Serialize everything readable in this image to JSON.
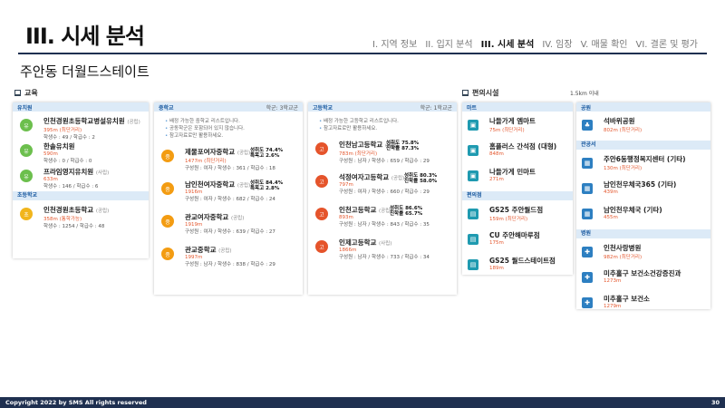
{
  "title": "III. 시세 분석",
  "nav": [
    "I. 지역 정보",
    "II. 입지 분석",
    "III. 시세 분석",
    "IV. 임장",
    "V. 매물 확인",
    "VI. 결론 및 평가"
  ],
  "subtitle": "주안동 더월드스테이트",
  "edu": {
    "header": "교육",
    "kinder": {
      "label": "유치원",
      "items": [
        {
          "name": "인천경원초등학교병설유치원",
          "tag": "(공립)",
          "dist": "395m",
          "near": "(최단거리)",
          "info": "학생수 : 49 / 학급수 : 2"
        },
        {
          "name": "한솔유치원",
          "tag": "",
          "dist": "590m",
          "near": "",
          "info": "학생수 : 0 / 학급수 : 0"
        },
        {
          "name": "프라임영지유치원",
          "tag": "(사립)",
          "dist": "633m",
          "near": "",
          "info": "학생수 : 146 / 학급수 : 6"
        }
      ]
    },
    "elem": {
      "label": "초등학교",
      "items": [
        {
          "name": "인천경원초등학교",
          "tag": "(공립)",
          "dist": "358m",
          "near": "(통학가능)",
          "info": "학생수 : 1254 / 학급수 : 48"
        }
      ]
    },
    "middle": {
      "label": "중학교",
      "right": "학군: 3학교군",
      "notes": [
        "배정 가능한 중학교 리스트입니다.",
        "공동학군은 포함되어 있지 않습니다.",
        "참고자료로만 활용하세요."
      ],
      "items": [
        {
          "name": "제물포여자중학교",
          "tag": "(공립)",
          "dist": "1477m",
          "near": "(최단거리)",
          "info": "구성원 : 여자 / 학생수 : 361 / 학급수 : 18",
          "rate1": "성취도 74.4%",
          "rate2": "특목고 2.6%"
        },
        {
          "name": "남인천여자중학교",
          "tag": "(공립)",
          "dist": "1916m",
          "near": "",
          "info": "구성원 : 여자 / 학생수 : 682 / 학급수 : 24",
          "rate1": "성취도 84.4%",
          "rate2": "특목고 2.8%"
        },
        {
          "name": "관교여자중학교",
          "tag": "(공립)",
          "dist": "1919m",
          "near": "",
          "info": "구성원 : 여자 / 학생수 : 639 / 학급수 : 27",
          "rate1": "",
          "rate2": ""
        },
        {
          "name": "관교중학교",
          "tag": "(공립)",
          "dist": "1997m",
          "near": "",
          "info": "구성원 : 남자 / 학생수 : 838 / 학급수 : 29",
          "rate1": "",
          "rate2": ""
        }
      ]
    },
    "high": {
      "label": "고등학교",
      "right": "학군: 1학교군",
      "notes": [
        "배정 가능한 고등학교 리스트입니다.",
        "참고자료로만 활용하세요."
      ],
      "items": [
        {
          "name": "인천남고등학교",
          "tag": "(공립)",
          "dist": "783m",
          "near": "(최단거리)",
          "info": "구성원 : 남자 / 학생수 : 659 / 학급수 : 29",
          "rate1": "성취도 75.8%",
          "rate2": "진학률 87.3%"
        },
        {
          "name": "석정여자고등학교",
          "tag": "(공립)",
          "dist": "797m",
          "near": "",
          "info": "구성원 : 여자 / 학생수 : 660 / 학급수 : 29",
          "rate1": "성취도 80.3%",
          "rate2": "진학률 58.0%"
        },
        {
          "name": "인천고등학교",
          "tag": "(공립)",
          "dist": "893m",
          "near": "",
          "info": "구성원 : 남자 / 학생수 : 843 / 학급수 : 35",
          "rate1": "성취도 86.6%",
          "rate2": "진학률 65.7%"
        },
        {
          "name": "인제고등학교",
          "tag": "(사립)",
          "dist": "1866m",
          "near": "",
          "info": "구성원 : 남자 / 학생수 : 733 / 학급수 : 34",
          "rate1": "",
          "rate2": ""
        }
      ]
    }
  },
  "conv": {
    "header": "편의시설",
    "range": "1.5km 이내",
    "mart": {
      "label": "마트",
      "items": [
        {
          "name": "나들가게 엠마트",
          "dist": "75m (최단거리)"
        },
        {
          "name": "홈플러스 간석점 (대형)",
          "dist": "848m"
        },
        {
          "name": "나들가게 민마트",
          "dist": "271m"
        }
      ]
    },
    "store": {
      "label": "편의점",
      "items": [
        {
          "name": "GS25 주안월드점",
          "dist": "159m (최단거리)"
        },
        {
          "name": "CU 주안해마루점",
          "dist": "175m"
        },
        {
          "name": "GS25 월드스테이트점",
          "dist": "189m"
        }
      ]
    },
    "park": {
      "label": "공원",
      "items": [
        {
          "name": "석바위공원",
          "dist": "802m (최단거리)"
        }
      ]
    },
    "office": {
      "label": "관공서",
      "items": [
        {
          "name": "주안6동행정복지센터 (기타)",
          "dist": "130m (최단거리)"
        },
        {
          "name": "남인천우체국365 (기타)",
          "dist": "439m"
        },
        {
          "name": "남인천우체국 (기타)",
          "dist": "455m"
        }
      ]
    },
    "hospital": {
      "label": "병원",
      "items": [
        {
          "name": "인천사랑병원",
          "dist": "982m (최단거리)"
        },
        {
          "name": "미추홀구 보건소건강증진과",
          "dist": "1273m"
        },
        {
          "name": "미추홀구 보건소",
          "dist": "1279m"
        }
      ]
    }
  },
  "footer": {
    "copyright": "Copyright 2022 by SMS All rights reserved",
    "page": "30"
  }
}
